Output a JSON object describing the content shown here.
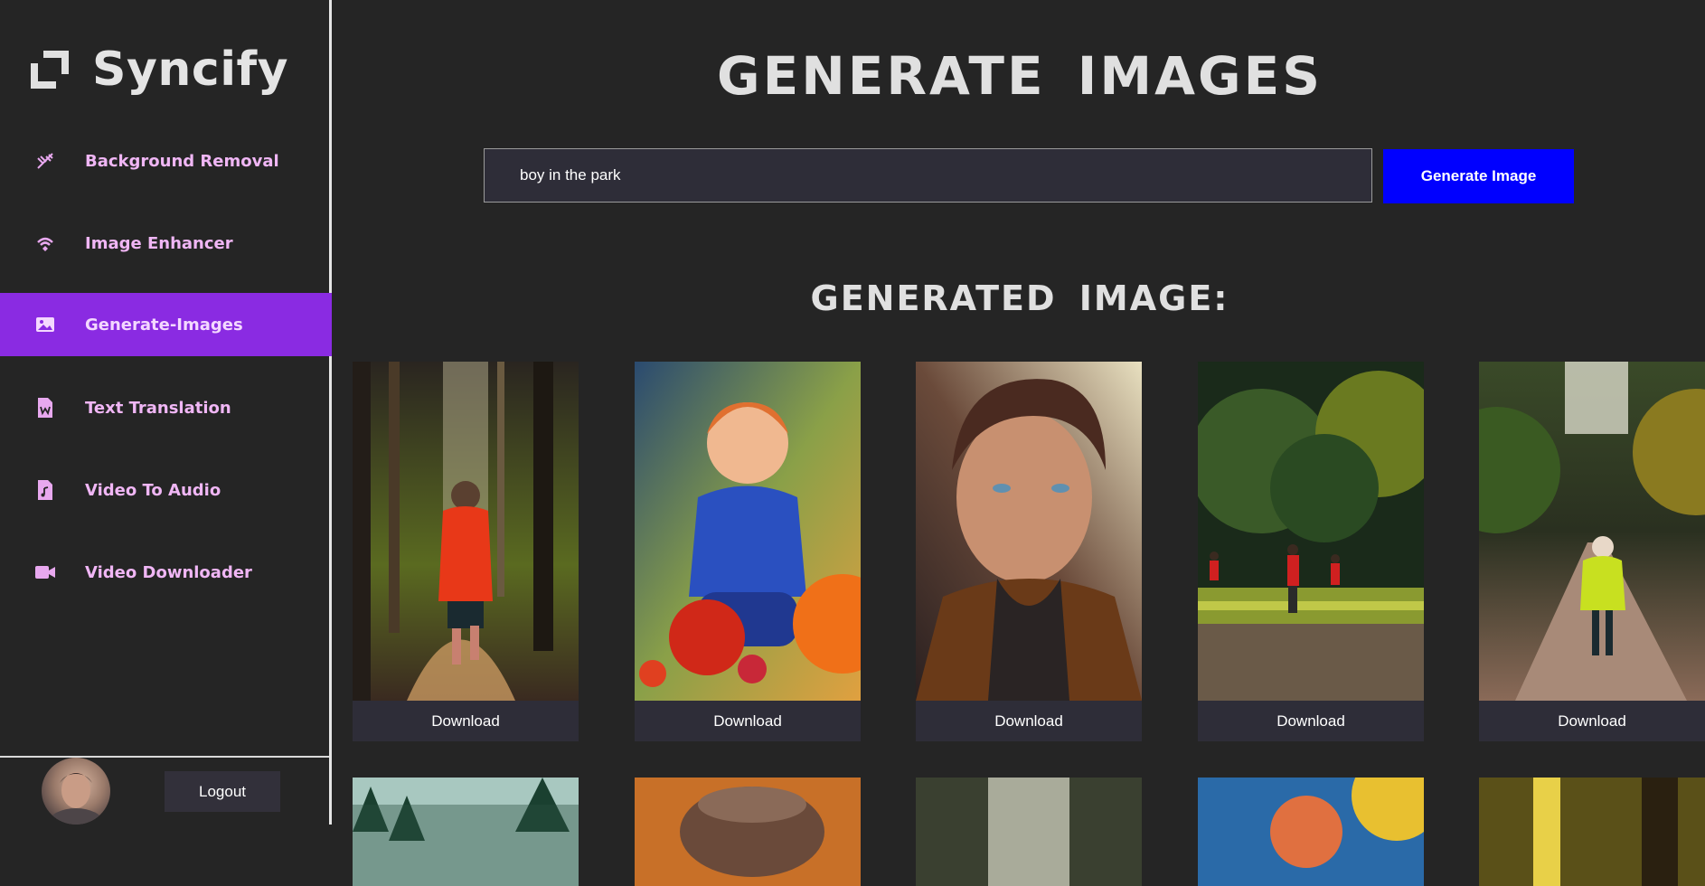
{
  "sidebar": {
    "brand": "Syncify",
    "items": [
      {
        "label": "Background Removal",
        "icon": "background-removal-icon"
      },
      {
        "label": "Image Enhancer",
        "icon": "image-enhancer-icon"
      },
      {
        "label": "Generate-Images",
        "icon": "image-icon",
        "active": true
      },
      {
        "label": "Text Translation",
        "icon": "word-document-icon"
      },
      {
        "label": "Video To Audio",
        "icon": "audio-file-icon"
      },
      {
        "label": "Video Downloader",
        "icon": "video-camera-icon"
      }
    ],
    "logout_label": "Logout"
  },
  "main": {
    "page_title": "GENERATE IMAGES",
    "prompt_value": "boy in the park",
    "generate_label": "Generate Image",
    "results_title": "GENERATED IMAGE:",
    "download_label": "Download"
  },
  "colors": {
    "background": "#252525",
    "accent_purple": "#8a2be2",
    "nav_text": "#f0b6f5",
    "button_blue": "#0000ff"
  }
}
